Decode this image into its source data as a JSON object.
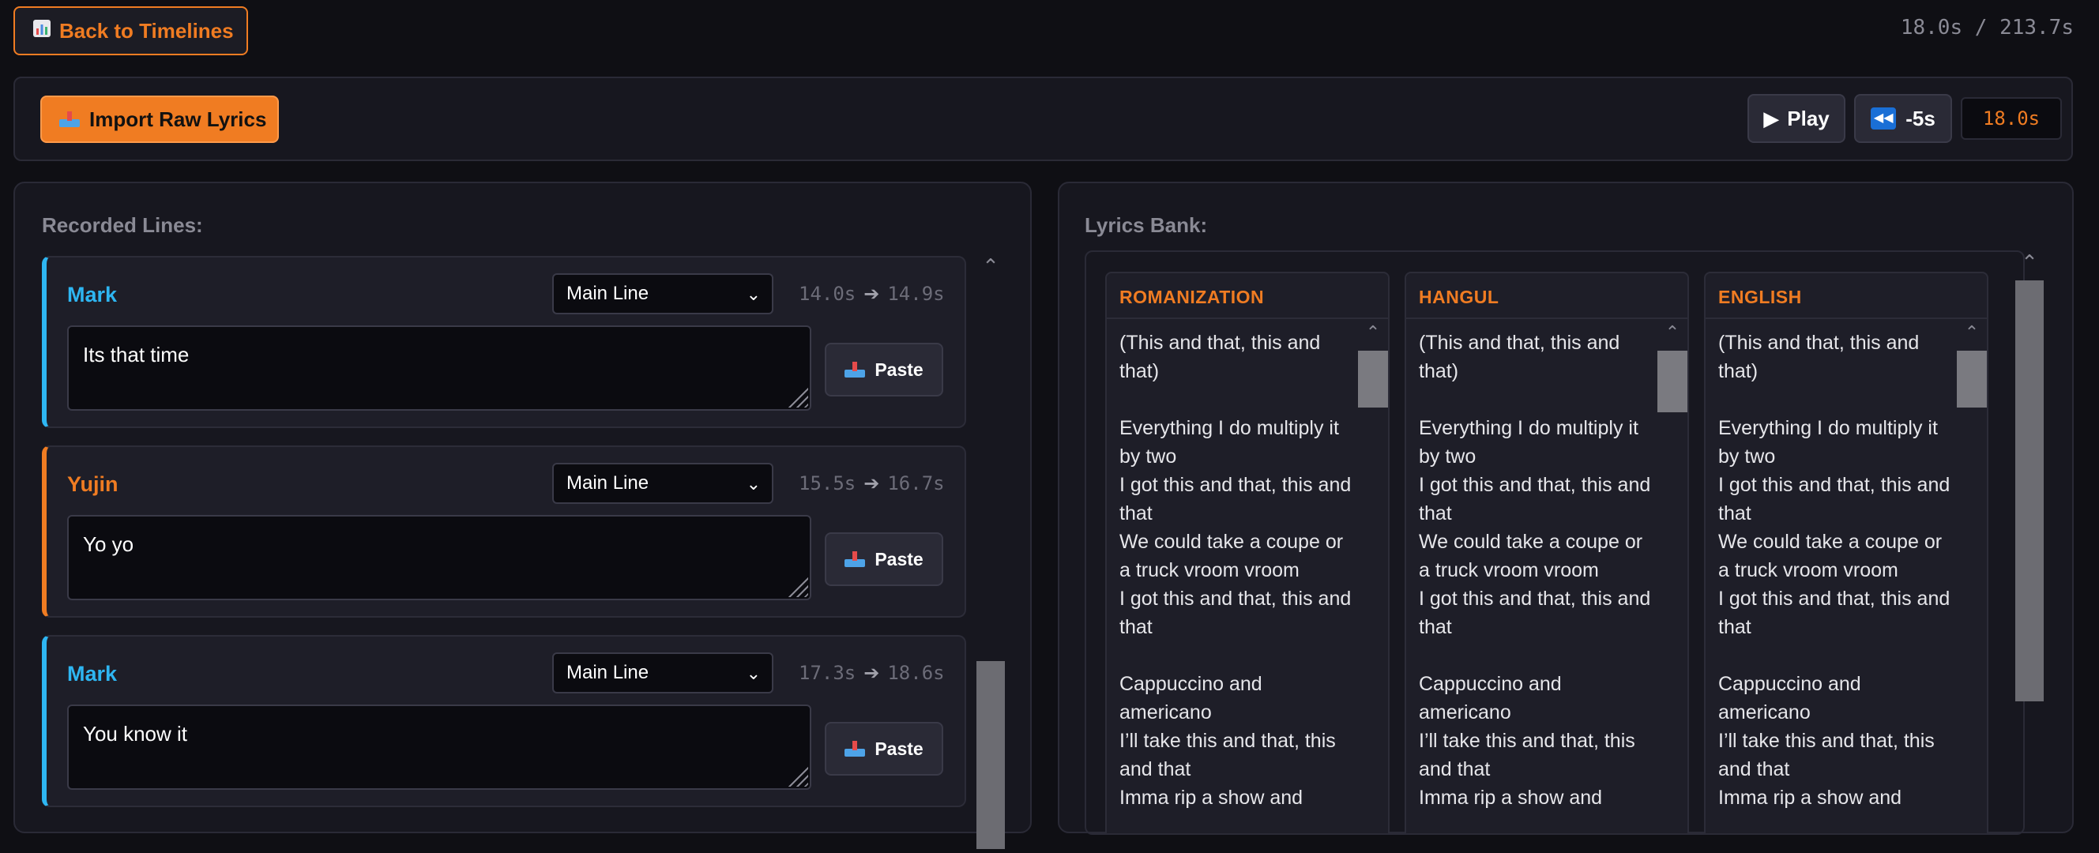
{
  "header": {
    "back_label": "Back to Timelines",
    "back_icon": "bar-chart-icon",
    "time_readout": "18.0s / 213.7s"
  },
  "toolbar": {
    "import_label": "Import Raw Lyrics",
    "import_icon": "inbox-tray-icon",
    "play_label": "Play",
    "play_icon": "play-icon",
    "rewind_label": "-5s",
    "rewind_icon": "rewind-icon",
    "current_time": "18.0s"
  },
  "recorded": {
    "title": "Recorded Lines:",
    "lines": [
      {
        "speaker": "Mark",
        "type": "Main Line",
        "start": "14.0s",
        "end": "14.9s",
        "text": "Its that time",
        "paste": "Paste"
      },
      {
        "speaker": "Yujin",
        "type": "Main Line",
        "start": "15.5s",
        "end": "16.7s",
        "text": "Yo yo",
        "paste": "Paste"
      },
      {
        "speaker": "Mark",
        "type": "Main Line",
        "start": "17.3s",
        "end": "18.6s",
        "text": "You know it",
        "paste": "Paste"
      }
    ]
  },
  "bank": {
    "title": "Lyrics Bank:",
    "columns": [
      {
        "header": "ROMANIZATION",
        "text": "(This and that, this and that)\n\nEverything I do multiply it by two\nI got this and that, this and that\nWe could take a coupe or a truck vroom vroom\nI got this and that, this and that\n\nCappuccino and americano\nI’ll take this and that, this and that\nImma rip a show and"
      },
      {
        "header": "HANGUL",
        "text": "(This and that, this and that)\n\nEverything I do multiply it by two\nI got this and that, this and that\nWe could take a coupe or a truck vroom vroom\nI got this and that, this and that\n\nCappuccino and americano\nI’ll take this and that, this and that\nImma rip a show and"
      },
      {
        "header": "ENGLISH",
        "text": "(This and that, this and that)\n\nEverything I do multiply it by two\nI got this and that, this and that\nWe could take a coupe or a truck vroom vroom\nI got this and that, this and that\n\nCappuccino and americano\nI’ll take this and that, this and that\nImma rip a show and"
      }
    ]
  },
  "colors": {
    "accent": "#f07c22",
    "speaker_blue": "#2eb6f2",
    "background": "#0f0f14"
  }
}
